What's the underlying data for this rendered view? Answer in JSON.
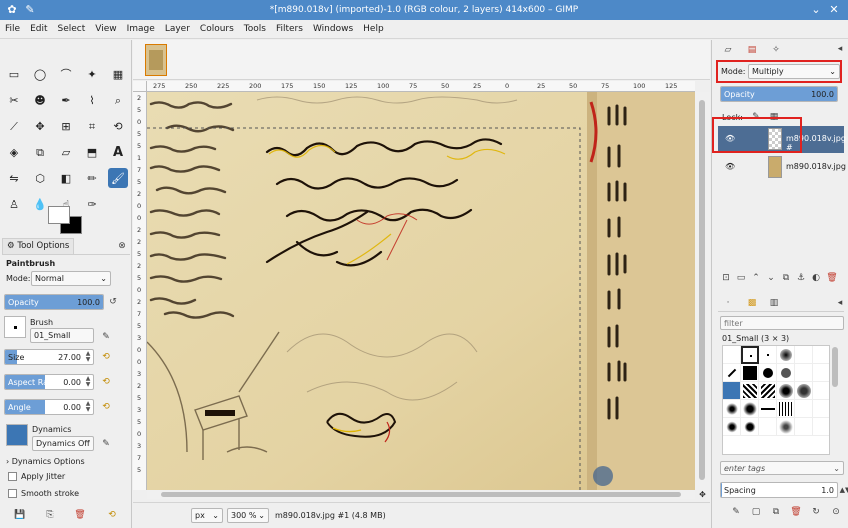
{
  "window": {
    "title": "*[m890.018v] (imported)-1.0 (RGB colour, 2 layers) 414x600 – GIMP"
  },
  "menu": [
    "File",
    "Edit",
    "Select",
    "View",
    "Image",
    "Layer",
    "Colours",
    "Tools",
    "Filters",
    "Windows",
    "Help"
  ],
  "ruler": {
    "h_ticks": [
      "275",
      "250",
      "225",
      "200",
      "175",
      "150",
      "125",
      "100",
      "75",
      "50",
      "25",
      "0",
      "25",
      "50",
      "75",
      "100",
      "125"
    ],
    "v_ticks": [
      "2",
      "5",
      "0",
      "5",
      "5",
      "1",
      "7",
      "5",
      "2",
      "0",
      "0",
      "2",
      "2",
      "5",
      "2",
      "5",
      "0",
      "2",
      "7",
      "5",
      "3",
      "0",
      "0",
      "3",
      "2",
      "5",
      "3",
      "5",
      "0",
      "3",
      "7",
      "5"
    ]
  },
  "tool_options": {
    "tab_label": "Tool Options",
    "title": "Paintbrush",
    "mode_label": "Mode:",
    "mode_value": "Normal",
    "opacity_label": "Opacity",
    "opacity_value": "100.0",
    "opacity_fraction": 1.0,
    "brush_label": "Brush",
    "brush_value": "01_Small",
    "size_label": "Size",
    "size_value": "27.00",
    "aspect_label": "Aspect Ratio",
    "aspect_value": "0.00",
    "angle_label": "Angle",
    "angle_value": "0.00",
    "dynamics_label": "Dynamics",
    "dynamics_value": "Dynamics Off",
    "dynamics_options": "Dynamics Options",
    "apply_jitter": "Apply Jitter",
    "smooth_stroke": "Smooth stroke"
  },
  "status": {
    "unit": "px",
    "zoom": "300 %",
    "info": "m890.018v.jpg #1 (4.8 MB)"
  },
  "layers": {
    "mode_label": "Mode:",
    "mode_value": "Multiply",
    "opacity_label": "Opacity",
    "opacity_value": "100.0",
    "lock_label": "Lock:",
    "items": [
      {
        "name": "m890.018v.jpg #",
        "selected": true
      },
      {
        "name": "m890.018v.jpg",
        "selected": false
      }
    ]
  },
  "brushes": {
    "filter_placeholder": "filter",
    "current": "01_Small (3 × 3)",
    "tags_placeholder": "enter tags",
    "spacing_label": "Spacing",
    "spacing_value": "1.0"
  },
  "colors": {
    "accent": "#3c76b4",
    "titlebar": "#4d89c8",
    "highlight_red": "#e0221f",
    "parchment": "#e7d9ae"
  }
}
